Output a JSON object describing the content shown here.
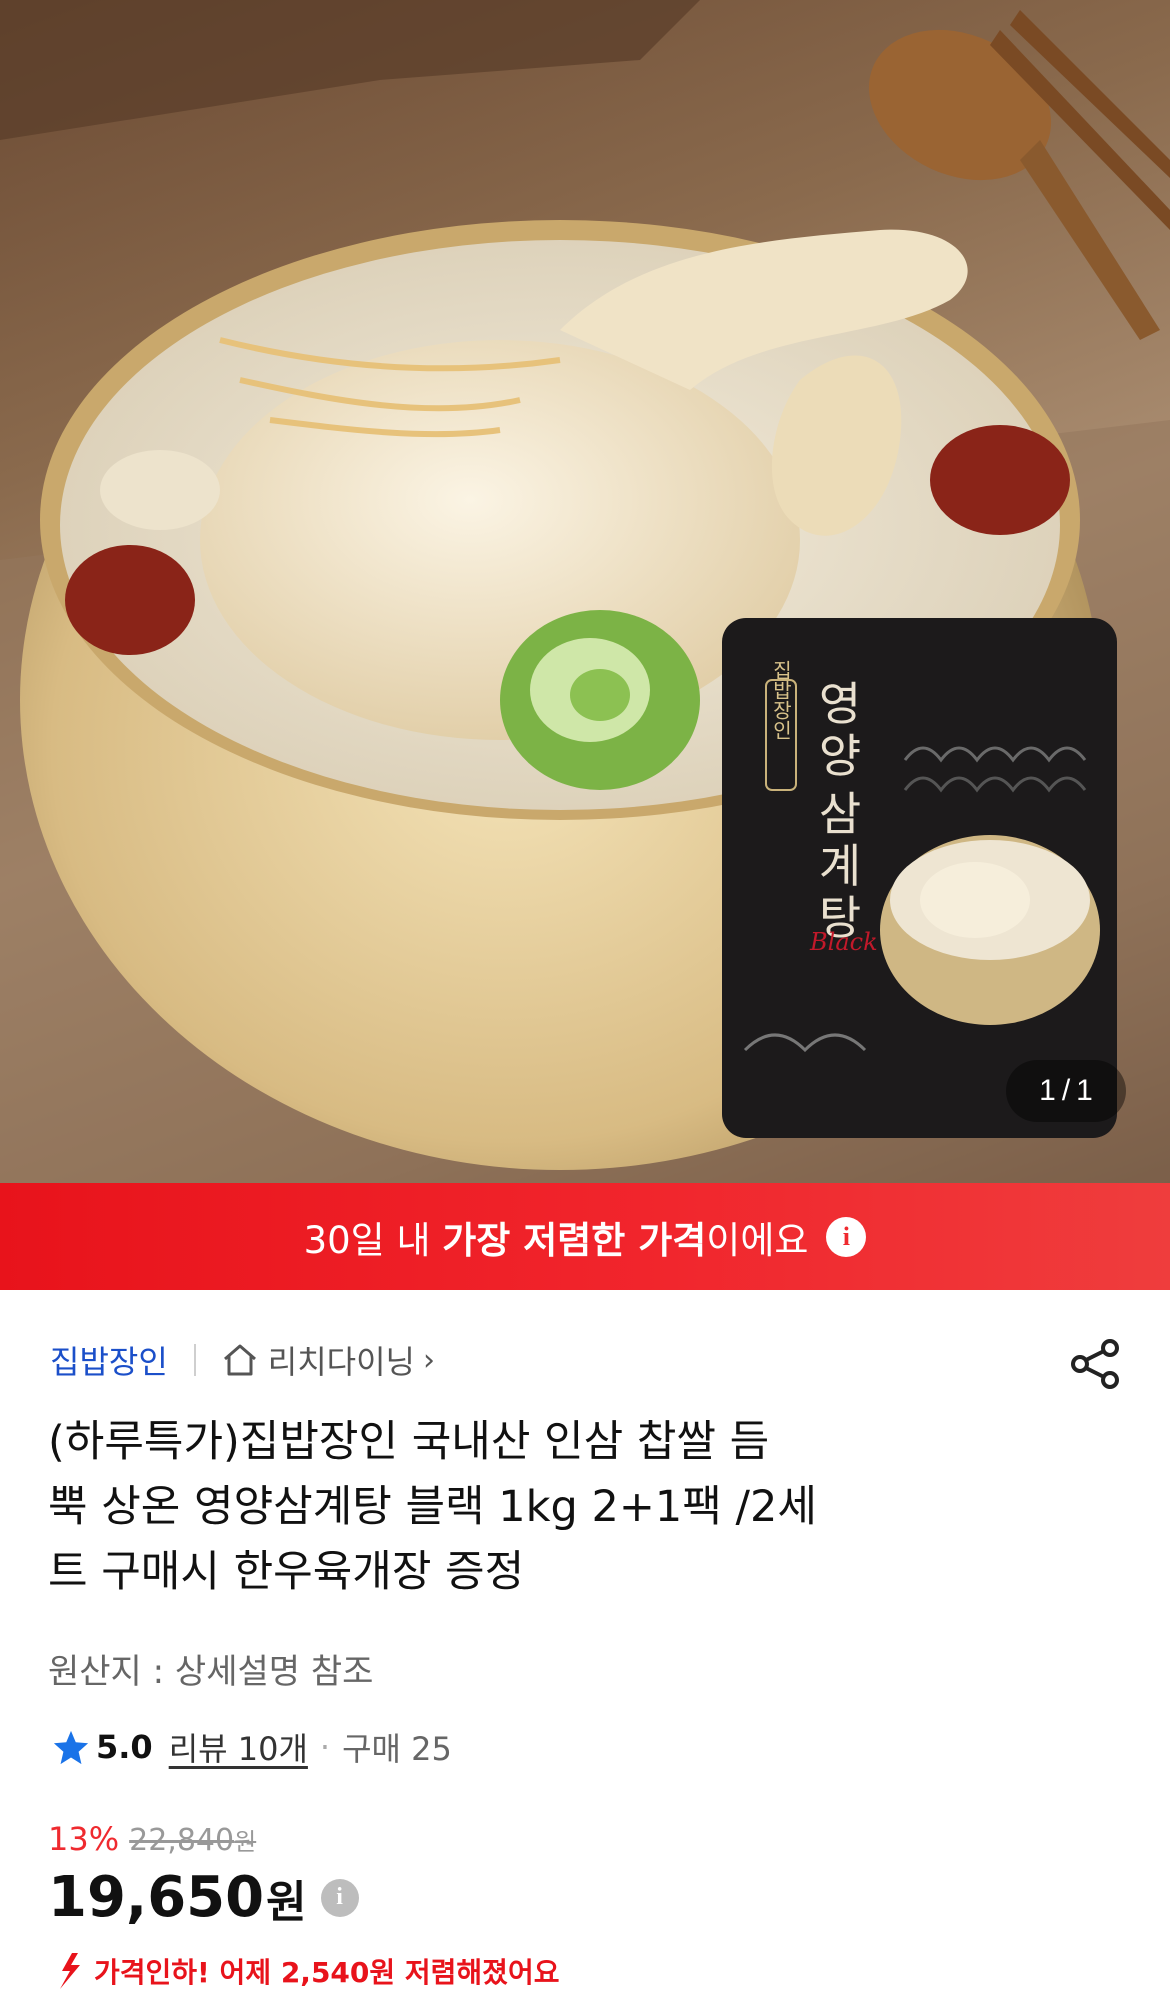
{
  "gallery": {
    "package": {
      "brand_vertical": "집밥장인",
      "name_vertical": [
        "영양",
        "삼계탕"
      ],
      "script_tag": "Black"
    },
    "pager": {
      "current": "1",
      "separator": "/",
      "total": "1"
    }
  },
  "banner": {
    "prefix": "30일 내 ",
    "highlight": "가장 저렴한 가격",
    "suffix": "이에요",
    "info_icon": "info-icon",
    "color": "#ef2a2f"
  },
  "store": {
    "brand": "집밥장인",
    "shop": "리치다이닝",
    "brand_color": "#1b4fc9"
  },
  "product": {
    "title_lines": [
      "(하루특가)집밥장인 국내산 인삼 찹쌀 듬",
      "뿍 상온 영양삼계탕 블랙 1kg 2+1팩 /2세",
      "트 구매시 한우육개장 증정"
    ],
    "origin": "원산지 : 상세설명 참조",
    "rating": "5.0",
    "reviews": "리뷰 10개",
    "purchases": "구매 25"
  },
  "price": {
    "discount": "13%",
    "original": "22,840",
    "original_unit": "원",
    "current": "19,650",
    "current_unit": "원",
    "drop_notice": "가격인하! 어제 2,540원 저렴해졌어요"
  }
}
